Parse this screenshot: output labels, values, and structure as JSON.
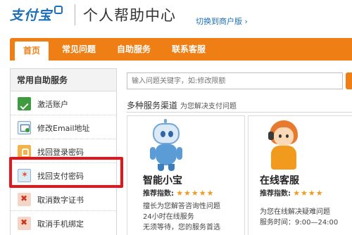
{
  "header": {
    "logo_text": "支付宝",
    "title": "个人帮助中心",
    "switch_link": "切换到商户版 ›"
  },
  "nav": {
    "tabs": [
      {
        "label": "首页",
        "active": true
      },
      {
        "label": "常见问题",
        "active": false
      },
      {
        "label": "自助服务",
        "active": false
      },
      {
        "label": "联系客服",
        "active": false
      }
    ]
  },
  "sidebar": {
    "title": "常用自助服务",
    "items": [
      {
        "label": "激活账户",
        "icon": "check-icon"
      },
      {
        "label": "修改Email地址",
        "icon": "email-edit-icon"
      },
      {
        "label": "找回登录密码",
        "icon": "lock-icon"
      },
      {
        "label": "找回支付密码",
        "icon": "key-star-icon",
        "highlighted": true
      },
      {
        "label": "取消数字证书",
        "icon": "cross-icon"
      },
      {
        "label": "取消手机绑定",
        "icon": "cross-icon"
      }
    ]
  },
  "search": {
    "placeholder": "输入问题关键字，如:修改限额"
  },
  "channels": {
    "title": "多种服务渠道",
    "subtitle": "为您解决支付问题",
    "cards": [
      {
        "name": "智能小宝",
        "rating_label": "推荐指数:",
        "stars": "★★★★★",
        "lines": [
          "擅长为您解答咨询性问题",
          "24小时在线服务",
          "无须等待，您的服务首选"
        ]
      },
      {
        "name": "在线客服",
        "rating_label": "推荐指数:",
        "stars": "★★★★",
        "lines": [
          "为您在线解决疑难问题",
          "服务时间：9:00—24:00"
        ]
      }
    ]
  },
  "colors": {
    "brand_blue": "#1c6fb8",
    "nav_orange": "#ef7e14",
    "highlight_red": "#e4161b"
  }
}
